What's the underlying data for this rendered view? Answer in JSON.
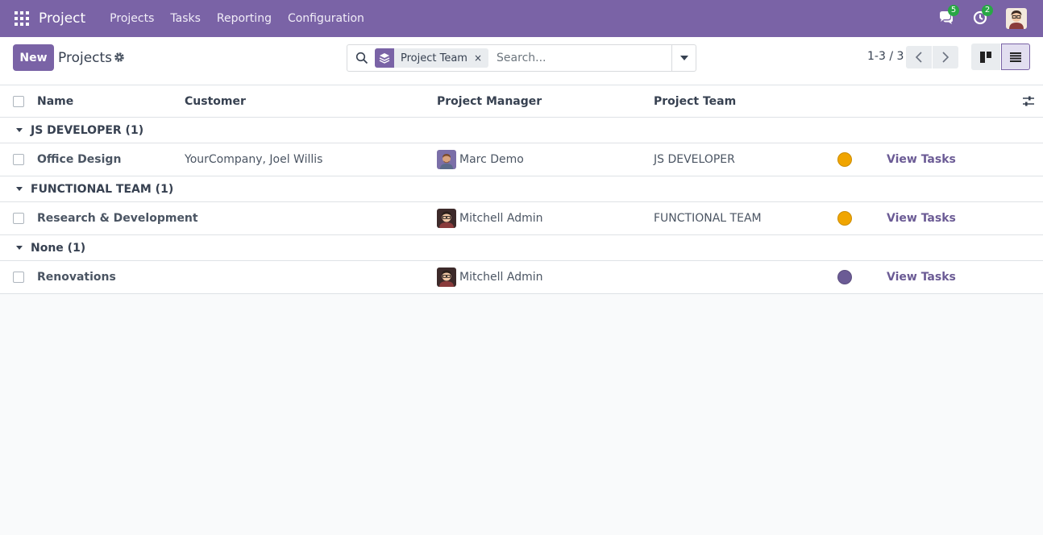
{
  "navbar": {
    "app_title": "Project",
    "menu": [
      "Projects",
      "Tasks",
      "Reporting",
      "Configuration"
    ],
    "messages_count": "5",
    "activities_count": "2",
    "bg_color": "#7a63a6"
  },
  "control_panel": {
    "new_label": "New",
    "title": "Projects",
    "facet_label": "Project Team",
    "facet_remove": "×",
    "search_placeholder": "Search...",
    "pager_value": "1-3 / 3"
  },
  "table": {
    "headers": {
      "name": "Name",
      "customer": "Customer",
      "manager": "Project Manager",
      "team": "Project Team"
    },
    "groups": [
      {
        "label": "JS DEVELOPER (1)",
        "rows": [
          {
            "name": "Office Design",
            "customer": "YourCompany, Joel Willis",
            "manager": "Marc Demo",
            "manager_avatar": "marc-demo-avatar",
            "team": "JS DEVELOPER",
            "color": "#f0a500",
            "action": "View Tasks"
          }
        ]
      },
      {
        "label": "FUNCTIONAL TEAM (1)",
        "rows": [
          {
            "name": "Research & Development",
            "customer": "",
            "manager": "Mitchell Admin",
            "manager_avatar": "mitchell-admin-avatar",
            "team": "FUNCTIONAL TEAM",
            "color": "#f0a500",
            "action": "View Tasks"
          }
        ]
      },
      {
        "label": "None (1)",
        "rows": [
          {
            "name": "Renovations",
            "customer": "",
            "manager": "Mitchell Admin",
            "manager_avatar": "mitchell-admin-avatar",
            "team": "",
            "color": "#6b5b95",
            "action": "View Tasks"
          }
        ]
      }
    ]
  }
}
